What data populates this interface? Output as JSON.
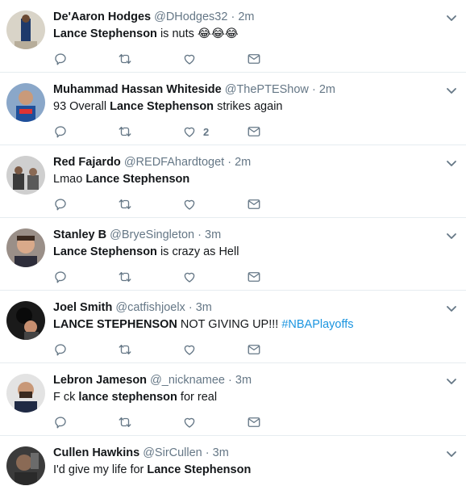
{
  "tweets": [
    {
      "name": "De'Aaron Hodges",
      "handle": "@DHodges32",
      "dot": "·",
      "time": "2m",
      "text_parts": [
        {
          "t": "Lance Stephenson",
          "b": true
        },
        {
          "t": " is nuts 😂😂😂",
          "b": false
        }
      ],
      "like_count": ""
    },
    {
      "name": "Muhammad Hassan Whiteside",
      "handle": "@ThePTEShow",
      "dot": "·",
      "time": "2m",
      "text_parts": [
        {
          "t": "93 Overall ",
          "b": false
        },
        {
          "t": "Lance Stephenson",
          "b": true
        },
        {
          "t": " strikes again",
          "b": false
        }
      ],
      "like_count": "2"
    },
    {
      "name": "Red Fajardo",
      "handle": "@REDFAhardtoget",
      "dot": "·",
      "time": "2m",
      "text_parts": [
        {
          "t": "Lmao ",
          "b": false
        },
        {
          "t": "Lance Stephenson",
          "b": true
        }
      ],
      "like_count": ""
    },
    {
      "name": "Stanley B",
      "handle": "@BryeSingleton",
      "dot": "·",
      "time": "3m",
      "text_parts": [
        {
          "t": "Lance Stephenson",
          "b": true
        },
        {
          "t": " is crazy as Hell",
          "b": false
        }
      ],
      "like_count": ""
    },
    {
      "name": "Joel Smith",
      "handle": "@catfishjoelx",
      "dot": "·",
      "time": "3m",
      "text_parts": [
        {
          "t": "LANCE STEPHENSON",
          "b": true
        },
        {
          "t": " NOT GIVING UP!!! ",
          "b": false
        },
        {
          "t": "#NBAPlayoffs",
          "b": false,
          "tag": true
        }
      ],
      "like_count": ""
    },
    {
      "name": "Lebron Jameson",
      "handle": "@_nicknamee",
      "dot": "·",
      "time": "3m",
      "text_parts": [
        {
          "t": "F  ck ",
          "b": false
        },
        {
          "t": "lance stephenson",
          "b": true
        },
        {
          "t": " for real",
          "b": false
        }
      ],
      "like_count": ""
    },
    {
      "name": "Cullen Hawkins",
      "handle": "@SirCullen",
      "dot": "·",
      "time": "3m",
      "text_parts": [
        {
          "t": "I'd give my life for ",
          "b": false
        },
        {
          "t": "Lance Stephenson",
          "b": true
        }
      ],
      "like_count": ""
    }
  ],
  "colors": {
    "icon": "#657786",
    "link": "#1b95e0",
    "divider": "#e6ecf0"
  },
  "icons": [
    "reply-icon",
    "retweet-icon",
    "like-icon",
    "direct-message-icon",
    "chevron-down-icon"
  ]
}
